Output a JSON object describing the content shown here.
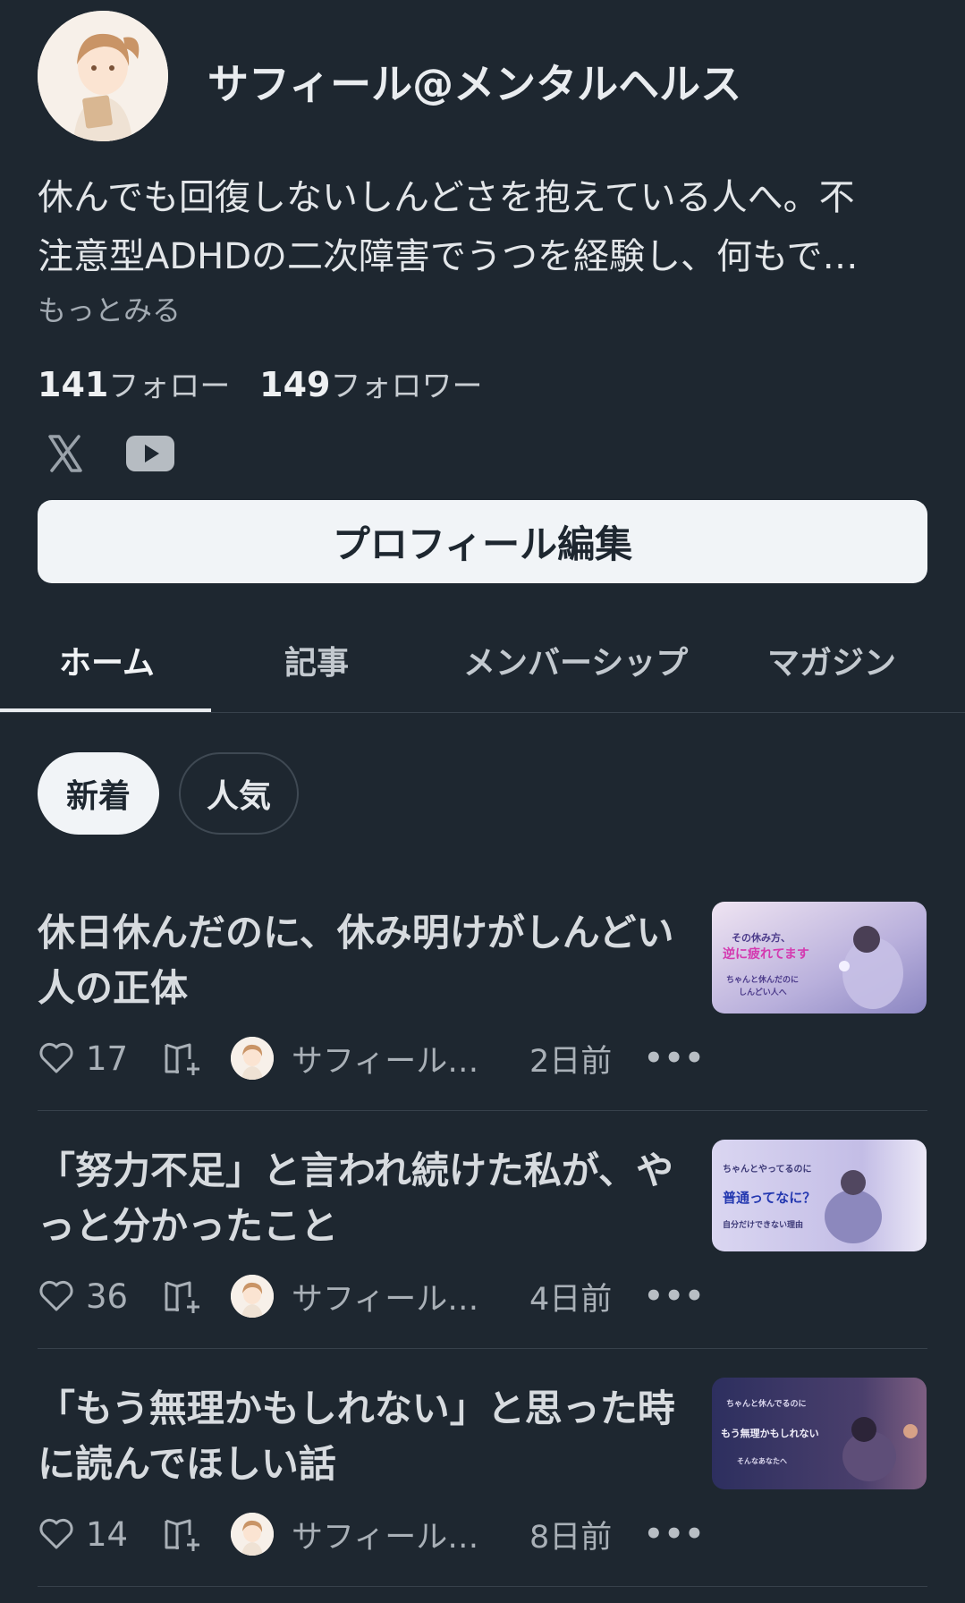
{
  "profile": {
    "name": "サフィール@メンタルヘルス",
    "bio_line1": "休んでも回復しないしんどさを抱えている人へ。不",
    "bio_line2": "注意型ADHDの二次障害でうつを経験し、何もで…",
    "more": "もっとみる",
    "follow_count": "141",
    "follow_label": "フォロー",
    "follower_count": "149",
    "follower_label": "フォロワー",
    "edit_button": "プロフィール編集"
  },
  "social_icons": [
    "x-icon",
    "youtube-icon"
  ],
  "tabs": [
    {
      "label": "ホーム",
      "active": true
    },
    {
      "label": "記事",
      "active": false
    },
    {
      "label": "メンバーシップ",
      "active": false
    },
    {
      "label": "マガジン",
      "active": false
    }
  ],
  "sort": {
    "new": "新着",
    "popular": "人気",
    "selected": "新着"
  },
  "articles": [
    {
      "title_line1": "休日休んだのに、休み明けがしんどい",
      "title_line2": "人の正体",
      "likes": "17",
      "author": "サフィール…",
      "date": "2日前",
      "thumb": {
        "line1": "その休み方、",
        "line2": "逆に疲れてます",
        "line3": "ちゃんと休んだのに",
        "line4": "しんどい人へ"
      }
    },
    {
      "title_line1": "「努力不足」と言われ続けた私が、や",
      "title_line2": "っと分かったこと",
      "likes": "36",
      "author": "サフィール…",
      "date": "4日前",
      "thumb": {
        "line1": "ちゃんとやってるのに",
        "line2": "普通ってなに？",
        "line3": "自分だけできない理由"
      }
    },
    {
      "title_line1": "「もう無理かもしれない」と思った時",
      "title_line2": "に読んでほしい話",
      "likes": "14",
      "author": "サフィール…",
      "date": "8日前",
      "thumb": {
        "line1": "ちゃんと休んでるのに",
        "line2": "もう無理かもしれない",
        "line3": "そんなあなたへ"
      }
    }
  ],
  "more_menu": "•••",
  "colors": {
    "background": "#1e2730",
    "text": "#e6e9ec",
    "muted": "#a9b0b7",
    "button_bg": "#f1f4f7"
  }
}
